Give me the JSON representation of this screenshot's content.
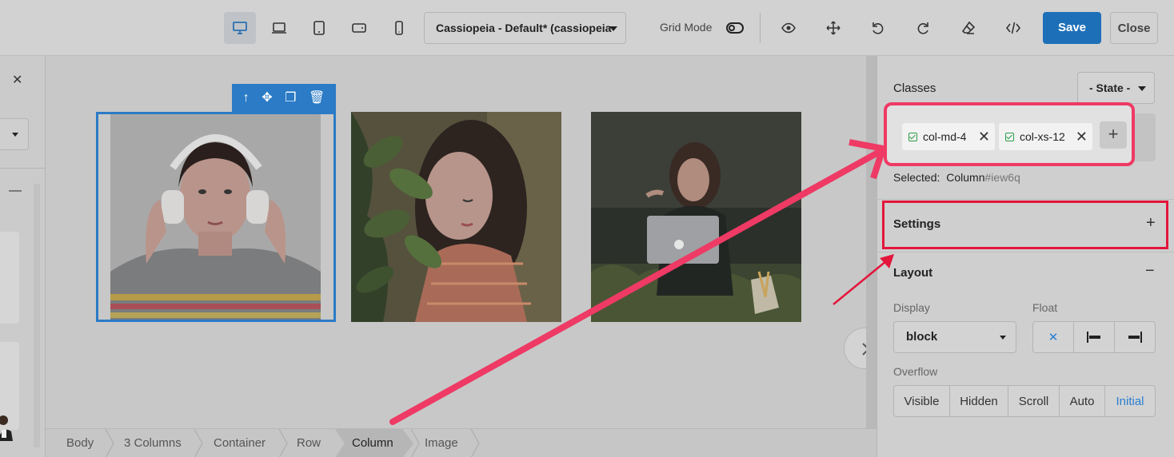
{
  "toolbar": {
    "template_select": "Cassiopeia - Default* (cassiopeia",
    "grid_mode_label": "Grid Mode",
    "save_label": "Save",
    "close_label": "Close"
  },
  "canvas": {
    "selection_tools": [
      "arrow-up-icon",
      "move-icon",
      "copy-icon",
      "trash-icon"
    ]
  },
  "breadcrumb": [
    "Body",
    "3 Columns",
    "Container",
    "Row",
    "Column",
    "Image"
  ],
  "breadcrumb_active": "Column",
  "right_panel": {
    "classes_label": "Classes",
    "state_select": "- State -",
    "classes": [
      "col-md-4",
      "col-xs-12"
    ],
    "selected_label": "Selected:",
    "selected_name": "Column",
    "selected_id": "#iew6q",
    "settings_label": "Settings",
    "layout_label": "Layout",
    "display_label": "Display",
    "display_value": "block",
    "float_label": "Float",
    "float_options": [
      "none-icon",
      "float-left-icon",
      "float-right-icon"
    ],
    "overflow_label": "Overflow",
    "overflow_options": [
      "Visible",
      "Hidden",
      "Scroll",
      "Auto",
      "Initial"
    ],
    "overflow_active": "Initial"
  },
  "colors": {
    "accent": "#1d6fb8",
    "selection": "#2b7bc6",
    "annotation": "#ee3a64"
  }
}
